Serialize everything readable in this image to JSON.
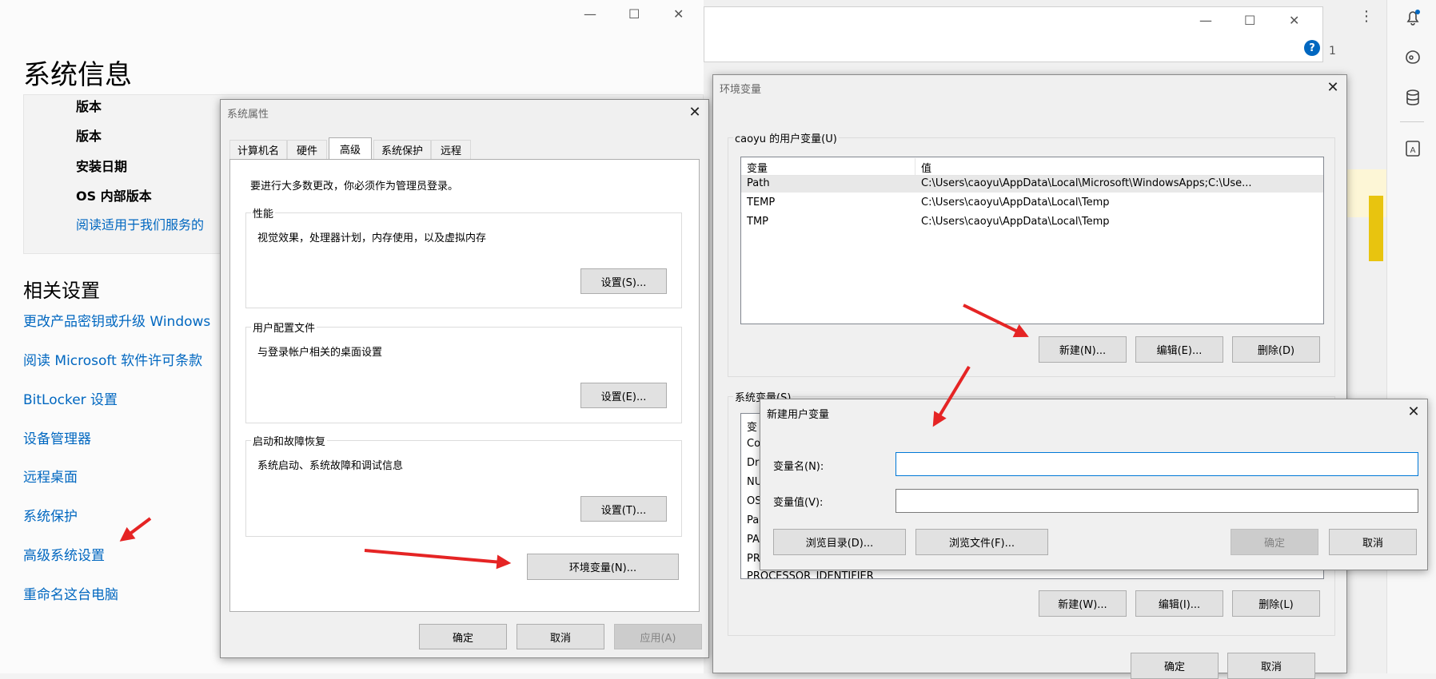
{
  "settings": {
    "title": "系统信息",
    "spec_rows": [
      "版本",
      "版本",
      "安装日期",
      "OS 内部版本"
    ],
    "spec_link": "阅读适用于我们服务的",
    "related_heading": "相关设置",
    "related_links": [
      "更改产品密钥或升级 Windows",
      "阅读 Microsoft 软件许可条款",
      "BitLocker 设置",
      "设备管理器",
      "远程桌面",
      "系统保护",
      "高级系统设置",
      "重命名这台电脑"
    ],
    "win_min": "—",
    "win_max": "☐",
    "win_close": "✕"
  },
  "back_window": {
    "help": "?",
    "page_indicator": "1"
  },
  "right_sidebar": {
    "icons": [
      "bell-icon",
      "copilot-icon",
      "database-icon",
      "reader-icon"
    ]
  },
  "sys_props": {
    "title": "系统属性",
    "tabs": [
      "计算机名",
      "硬件",
      "高级",
      "系统保护",
      "远程"
    ],
    "admin_note": "要进行大多数更改，你必须作为管理员登录。",
    "perf_label": "性能",
    "perf_desc": "视觉效果，处理器计划，内存使用，以及虚拟内存",
    "perf_btn": "设置(S)...",
    "profile_label": "用户配置文件",
    "profile_desc": "与登录帐户相关的桌面设置",
    "profile_btn": "设置(E)...",
    "startup_label": "启动和故障恢复",
    "startup_desc": "系统启动、系统故障和调试信息",
    "startup_btn": "设置(T)...",
    "env_btn": "环境变量(N)...",
    "ok": "确定",
    "cancel": "取消",
    "apply": "应用(A)"
  },
  "env_vars": {
    "title": "环境变量",
    "user_group": "caoyu 的用户变量(U)",
    "col_var": "变量",
    "col_val": "值",
    "user_rows": [
      {
        "name": "Path",
        "value": "C:\\Users\\caoyu\\AppData\\Local\\Microsoft\\WindowsApps;C:\\Use..."
      },
      {
        "name": "TEMP",
        "value": "C:\\Users\\caoyu\\AppData\\Local\\Temp"
      },
      {
        "name": "TMP",
        "value": "C:\\Users\\caoyu\\AppData\\Local\\Temp"
      }
    ],
    "user_new": "新建(N)...",
    "user_edit": "编辑(E)...",
    "user_delete": "删除(D)",
    "sys_group": "系统变量(S)",
    "sys_rows": [
      "变",
      "Co",
      "Dr",
      "NU",
      "OS",
      "Pa",
      "PA",
      "PR",
      "PROCESSOR_IDENTIFIER"
    ],
    "sys_new": "新建(W)...",
    "sys_edit": "编辑(I)...",
    "sys_delete": "删除(L)",
    "ok": "确定",
    "cancel": "取消"
  },
  "new_var": {
    "title": "新建用户变量",
    "name_label": "变量名(N):",
    "value_label": "变量值(V):",
    "name_value": "",
    "value_value": "",
    "browse_dir": "浏览目录(D)...",
    "browse_file": "浏览文件(F)...",
    "ok": "确定",
    "cancel": "取消"
  }
}
